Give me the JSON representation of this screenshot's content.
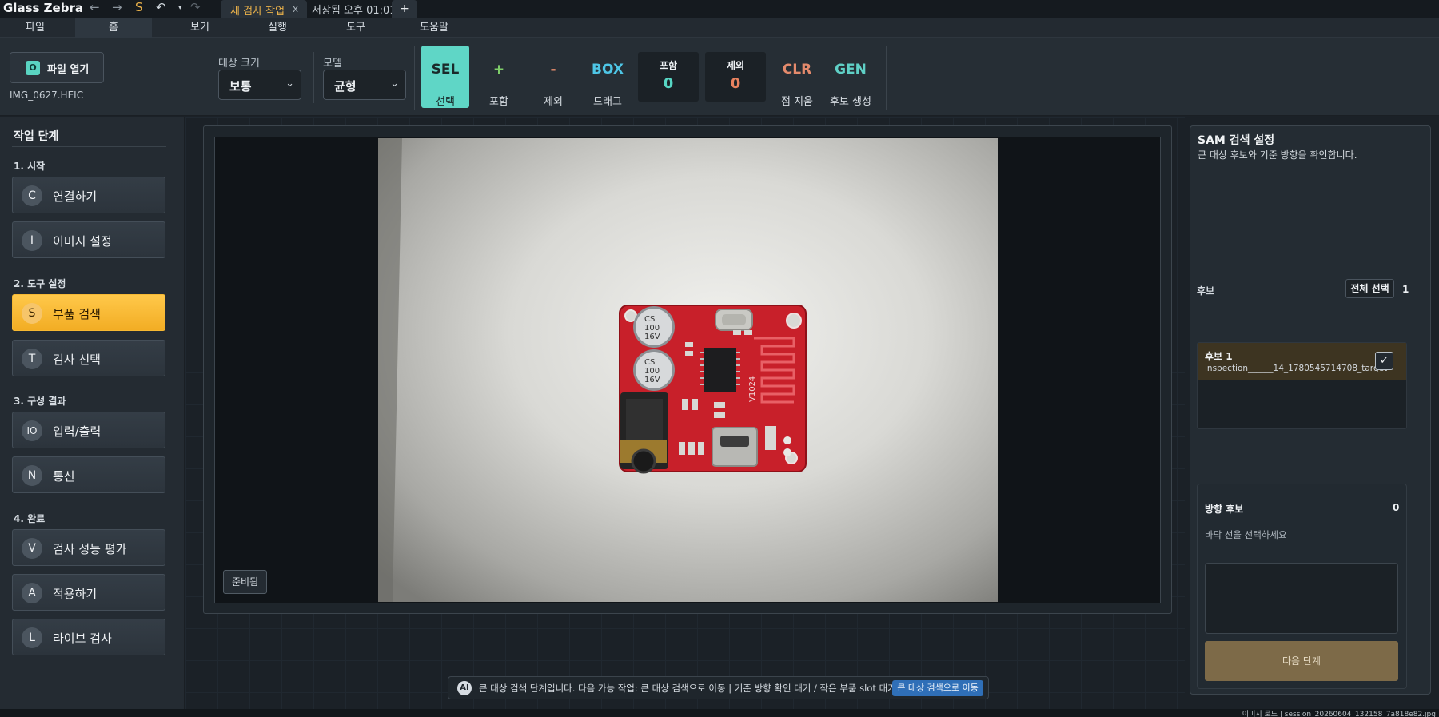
{
  "titlebar": {
    "app_name": "Glass Zebra",
    "s_glyph": "S",
    "doc_tab": "새 검사 작업",
    "doc_tab_close": "x",
    "save_status": "저장됨 오후 01:01",
    "new_tab": "+"
  },
  "menu": [
    "파일",
    "홈",
    "보기",
    "실행",
    "도구",
    "도움말"
  ],
  "ribbon": {
    "open_button": {
      "icon": "O",
      "label": "파일 열기"
    },
    "file_name": "IMG_0627.HEIC",
    "target_size": {
      "label": "대상 크기",
      "value": "보통"
    },
    "model": {
      "label": "모델",
      "value": "균형"
    },
    "tools": [
      {
        "glyph": "SEL",
        "label": "선택",
        "color": "#1a2a2a"
      },
      {
        "glyph": "+",
        "label": "포함",
        "color": "#7fcf6a"
      },
      {
        "glyph": "-",
        "label": "제외",
        "color": "#e08a6a"
      },
      {
        "glyph": "BOX",
        "label": "드래그",
        "color": "#4ec6e6"
      }
    ],
    "include_counter": {
      "label": "포함",
      "value": "0",
      "color": "#57d6c4"
    },
    "exclude_counter": {
      "label": "제외",
      "value": "0",
      "color": "#e8825f"
    },
    "clear_tool": {
      "glyph": "CLR",
      "label": "점 지움",
      "color": "#e48a6c"
    },
    "gen_tool": {
      "glyph": "GEN",
      "label": "후보 생성",
      "color": "#5fd0c6"
    }
  },
  "left_panel": {
    "title": "작업 단계",
    "sections": [
      {
        "label": "1. 시작",
        "steps": [
          {
            "badge": "C",
            "label": "연결하기"
          },
          {
            "badge": "I",
            "label": "이미지 설정"
          }
        ]
      },
      {
        "label": "2. 도구 설정",
        "steps": [
          {
            "badge": "S",
            "label": "부품 검색",
            "active": true
          },
          {
            "badge": "T",
            "label": "검사 선택"
          }
        ]
      },
      {
        "label": "3. 구성 결과",
        "steps": [
          {
            "badge": "IO",
            "label": "입력/출력"
          },
          {
            "badge": "N",
            "label": "통신"
          }
        ]
      },
      {
        "label": "4. 완료",
        "steps": [
          {
            "badge": "V",
            "label": "검사 성능 평가"
          },
          {
            "badge": "A",
            "label": "적용하기"
          },
          {
            "badge": "L",
            "label": "라이브 검사"
          }
        ]
      }
    ]
  },
  "viewer": {
    "ready_badge": "준비됨",
    "capacitor_1": [
      "CS",
      "100",
      "16V"
    ],
    "capacitor_2": [
      "CS",
      "100",
      "16V"
    ],
    "pcb_mark": "V1024"
  },
  "status_bar": {
    "ai_badge": "AI",
    "message": "큰 대상 검색 단계입니다. 다음 가능 작업: 큰 대상 검색으로 이동 | 기준 방향 확인 대기 / 작은 부품 slot 대기",
    "action_button": "큰 대상 검색으로 이동"
  },
  "right_panel": {
    "title": "SAM 검색 설정",
    "subtitle": "큰 대상 후보와 기준 방향을 확인합니다.",
    "candidates_label": "후보",
    "select_all": "전체 선택",
    "candidates_count": "1",
    "candidate": {
      "name": "후보 1",
      "id": "inspection______14_1780545714708_target",
      "check": "✓"
    },
    "direction_label": "방향 후보",
    "direction_count": "0",
    "direction_hint": "바닥 선을 선택하세요",
    "next_button": "다음 단계"
  },
  "footer": {
    "text": "이미지 로드 | session_20260604_132158_7a818e82.jpg"
  }
}
